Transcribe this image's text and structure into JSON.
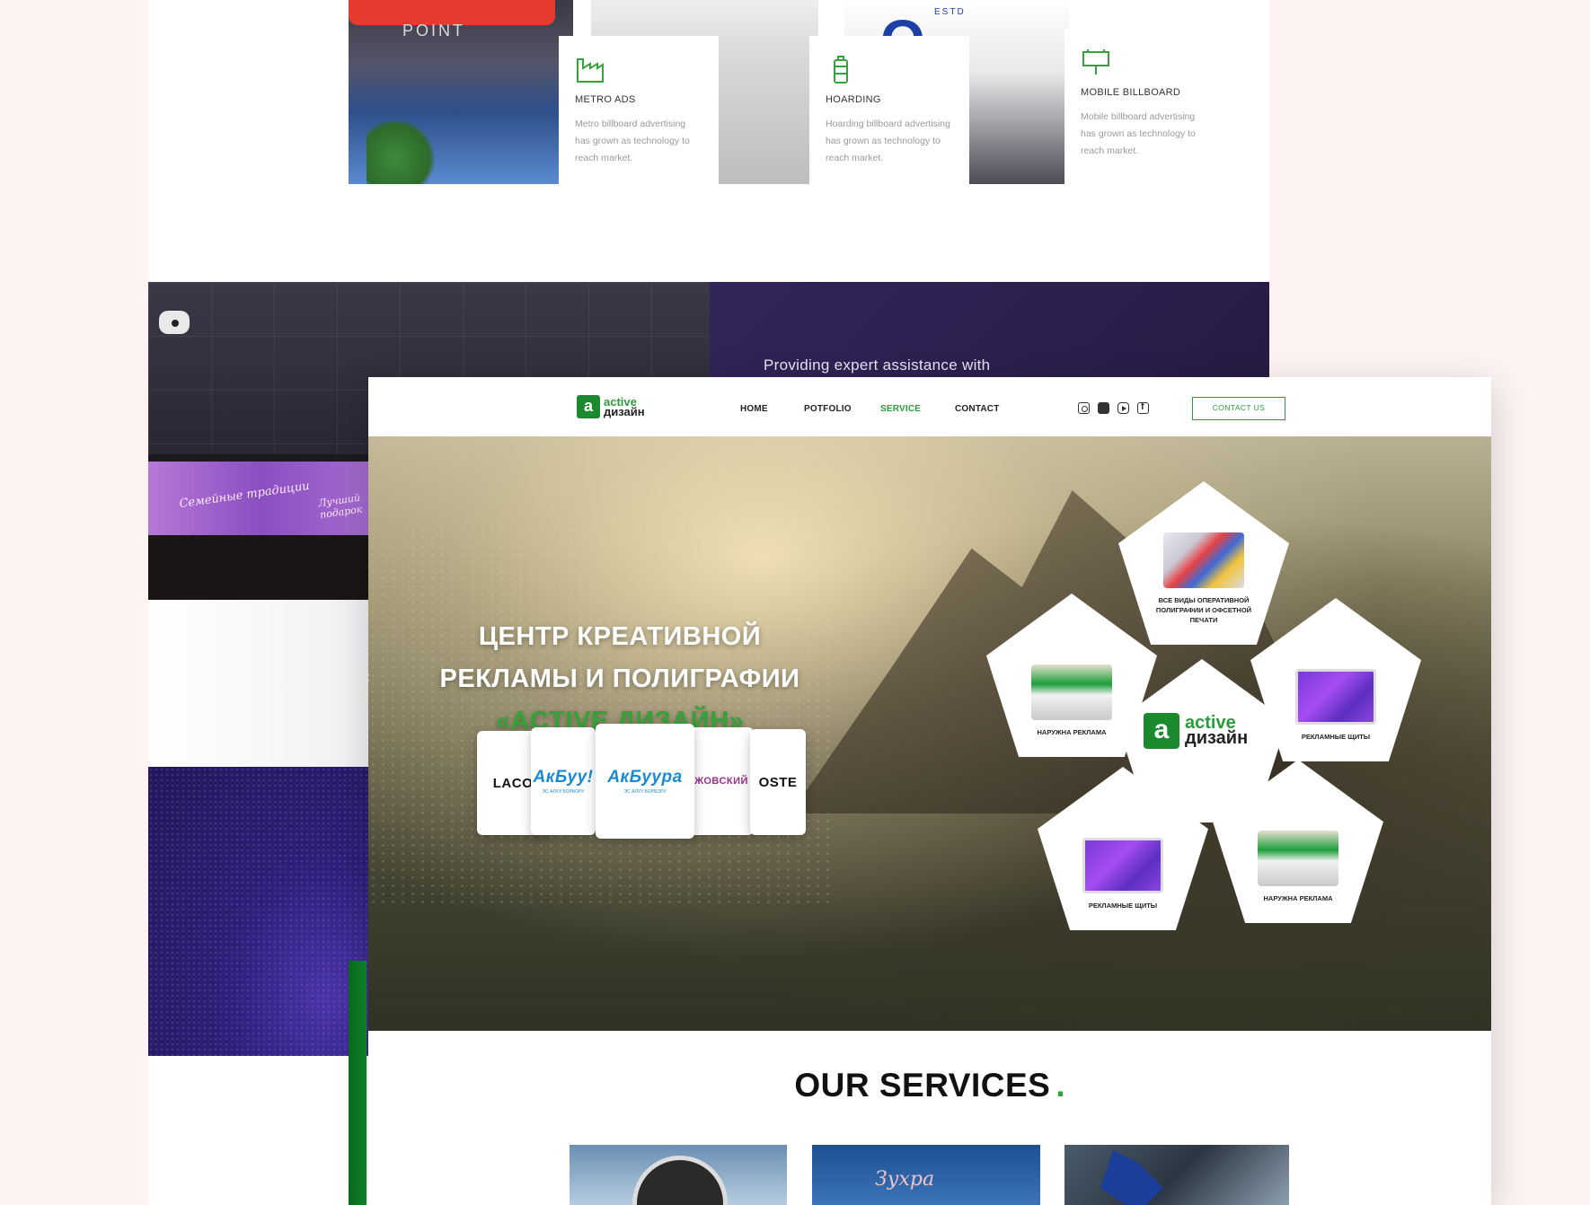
{
  "back_page": {
    "features": [
      {
        "title": "METRO ADS",
        "description": "Metro billboard advertising has grown as technology to reach market.",
        "icon": "factory-icon"
      },
      {
        "title": "HOARDING",
        "description": "Hoarding billboard advertising has grown as technology to reach market.",
        "icon": "battery-icon"
      },
      {
        "title": "MOBILE BILLBOARD",
        "description": "Mobile billboard advertising has grown as technology to reach market.",
        "icon": "billboard-icon"
      }
    ],
    "photo_texts": {
      "coffee_point": "POINT",
      "mobile_estd": "ESTD",
      "mobile_brand": "O"
    },
    "screen_texts": [
      "Семейные традиции",
      "Лучший подарок"
    ],
    "assist_text": "Providing expert assistance with"
  },
  "front_page": {
    "logo": {
      "badge": "a",
      "top": "active",
      "bottom": "дизайн"
    },
    "nav": {
      "home": "HOME",
      "portfolio": "POTFOLIO",
      "service": "SERVICE",
      "contact": "CONTACT"
    },
    "social": [
      "instagram-icon",
      "twitter-icon",
      "youtube-icon",
      "facebook-icon"
    ],
    "contact_button": "CONTACT US",
    "hero": {
      "line1": "ЦЕНТР КРЕАТИВНОЙ",
      "line2": "РЕКЛАМЫ И ПОЛИГРАФИИ",
      "line3": "«ACTIVE ДИЗАЙН»",
      "arrow": "‹"
    },
    "clients": {
      "c1": "LACO",
      "c2": "АкБуу!",
      "c2_sub": "ЭС АЛУУ БОРБОРУ",
      "c3": "АкБуура",
      "c3_sub": "ЭС АЛУУ БОРБОРУ",
      "c4": "ЖОВСКИЙ",
      "c5": "OSTE"
    },
    "pentagons": {
      "top": "ВСЕ ВИДЫ ОПЕРАТИВНОЙ ПОЛИГРАФИИ И ОФСЕТНОЙ ПЕЧАТИ",
      "left": "НАРУЖНА РЕКЛАМА",
      "right": "РЕКЛАМНЫЕ ЩИТЫ",
      "bottom_left": "РЕКЛАМНЫЕ ЩИТЫ",
      "bottom_right": "НАРУЖНА РЕКЛАМА",
      "center_top": "active",
      "center_bottom": "дизайн",
      "center_badge": "a"
    },
    "services": {
      "title": "OUR SERVICES",
      "dot": ".",
      "thumb2_text": "Зухра"
    },
    "colors": {
      "brand_green": "#35a33a",
      "dark_green": "#1b8a2e",
      "purple": "#2a1d4a"
    }
  }
}
